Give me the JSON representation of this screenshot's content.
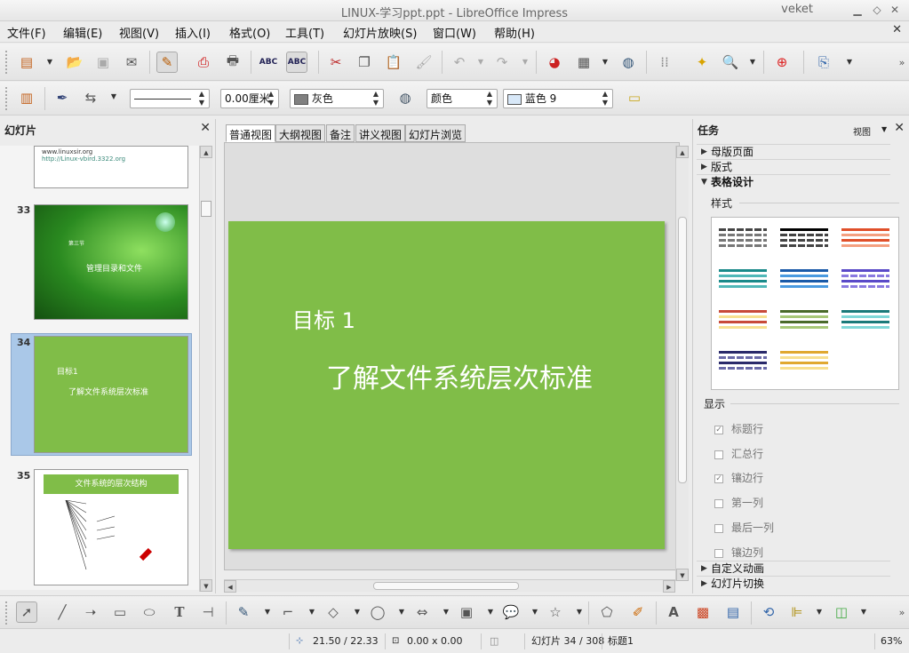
{
  "window": {
    "title": "LINUX-学习ppt.ppt - LibreOffice Impress",
    "user": "veket"
  },
  "menu": [
    "文件(F)",
    "编辑(E)",
    "视图(V)",
    "插入(I)",
    "格式(O)",
    "工具(T)",
    "幻灯片放映(S)",
    "窗口(W)",
    "帮助(H)"
  ],
  "format": {
    "line_width": "0.00厘米",
    "line_color": "灰色",
    "fill_type": "颜色",
    "fill_color": "蓝色 9"
  },
  "slides_pane": {
    "title": "幻灯片",
    "slides": [
      {
        "number": "",
        "lines": [
          "www.linuxsir.org",
          "http://Linux-vbird.3322.org"
        ]
      },
      {
        "number": "33",
        "lines": [
          "第三节",
          "管理目录和文件"
        ]
      },
      {
        "number": "34",
        "lines": [
          "目标1",
          "了解文件系统层次标准"
        ]
      },
      {
        "number": "35",
        "lines": [
          "文件系统的层次结构"
        ]
      }
    ]
  },
  "views": [
    "普通视图",
    "大纲视图",
    "备注",
    "讲义视图",
    "幻灯片浏览"
  ],
  "slide": {
    "title": "目标 1",
    "body": "了解文件系统层次标准"
  },
  "task_pane": {
    "title": "任务",
    "view_label": "视图",
    "sections": [
      "母版页面",
      "版式",
      "表格设计"
    ],
    "style_label": "样式",
    "show_label": "显示",
    "options": [
      {
        "label": "标题行",
        "checked": true
      },
      {
        "label": "汇总行",
        "checked": false
      },
      {
        "label": "镶边行",
        "checked": true
      },
      {
        "label": "第一列",
        "checked": false
      },
      {
        "label": "最后一列",
        "checked": false
      },
      {
        "label": "镶边列",
        "checked": false
      }
    ],
    "bottom_sections": [
      "自定义动画",
      "幻灯片切换"
    ]
  },
  "status": {
    "position": "21.50 / 22.33",
    "size": "0.00 x 0.00",
    "slide": "幻灯片 34 / 308",
    "layout": "标题1",
    "zoom": "63%"
  },
  "colors": {
    "slide_bg": "#80bd48",
    "thumb_highlight": "#aac8e8"
  }
}
